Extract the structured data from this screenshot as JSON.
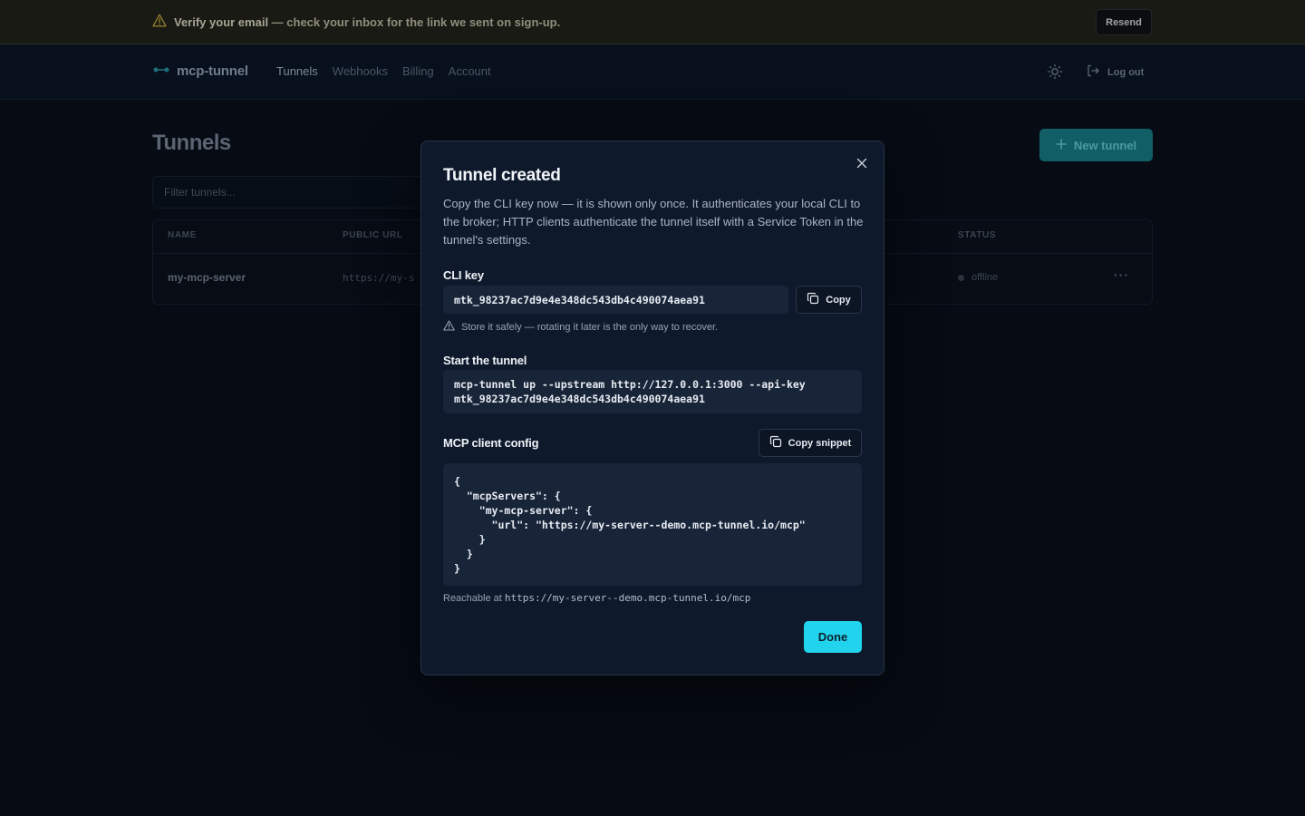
{
  "banner": {
    "strong": "Verify your email",
    "text": " — check your inbox for the link we sent on sign-up.",
    "resend_label": "Resend"
  },
  "nav": {
    "brand": "mcp-tunnel",
    "links": [
      {
        "label": "Tunnels",
        "active": true
      },
      {
        "label": "Webhooks",
        "active": false
      },
      {
        "label": "Billing",
        "active": false
      },
      {
        "label": "Account",
        "active": false
      }
    ],
    "logout_label": "Log out"
  },
  "main": {
    "title": "Tunnels",
    "new_tunnel_label": "New tunnel",
    "filter_placeholder": "Filter tunnels...",
    "table": {
      "headers": {
        "name": "NAME",
        "public_url": "PUBLIC URL",
        "status": "STATUS"
      },
      "rows": [
        {
          "name": "my-mcp-server",
          "url": "https://my-s",
          "status": "offline"
        }
      ],
      "row_menu": "···"
    }
  },
  "modal": {
    "title": "Tunnel created",
    "description": "Copy the CLI key now — it is shown only once. It authenticates your local CLI to the broker; HTTP clients authenticate the tunnel itself with a Service Token in the tunnel's settings.",
    "cli_key_label": "CLI key",
    "cli_key": "mtk_98237ac7d9e4e348dc543db4c490074aea91",
    "copy_label": "Copy",
    "warning": "Store it safely — rotating it later is the only way to recover.",
    "start_label": "Start the tunnel",
    "command_lines": [
      "mcp-tunnel up --upstream http://127.0.0.1:3000 --api-key",
      "mtk_98237ac7d9e4e348dc543db4c490074aea91"
    ],
    "config_label": "MCP client config",
    "copy_snippet_label": "Copy snippet",
    "config_lines": [
      "{",
      "  \"mcpServers\": {",
      "    \"my-mcp-server\": {",
      "      \"url\": \"https://my-server--demo.mcp-tunnel.io/mcp\"",
      "    }",
      "  }",
      "}"
    ],
    "reachable_prefix": "Reachable at",
    "reachable_url": "https://my-server--demo.mcp-tunnel.io/mcp",
    "done_label": "Done"
  },
  "colors": {
    "accent": "#22d3ee",
    "modal_bg": "#0e1a2c",
    "page_bg": "#060b14",
    "warning": "#c9a227"
  }
}
